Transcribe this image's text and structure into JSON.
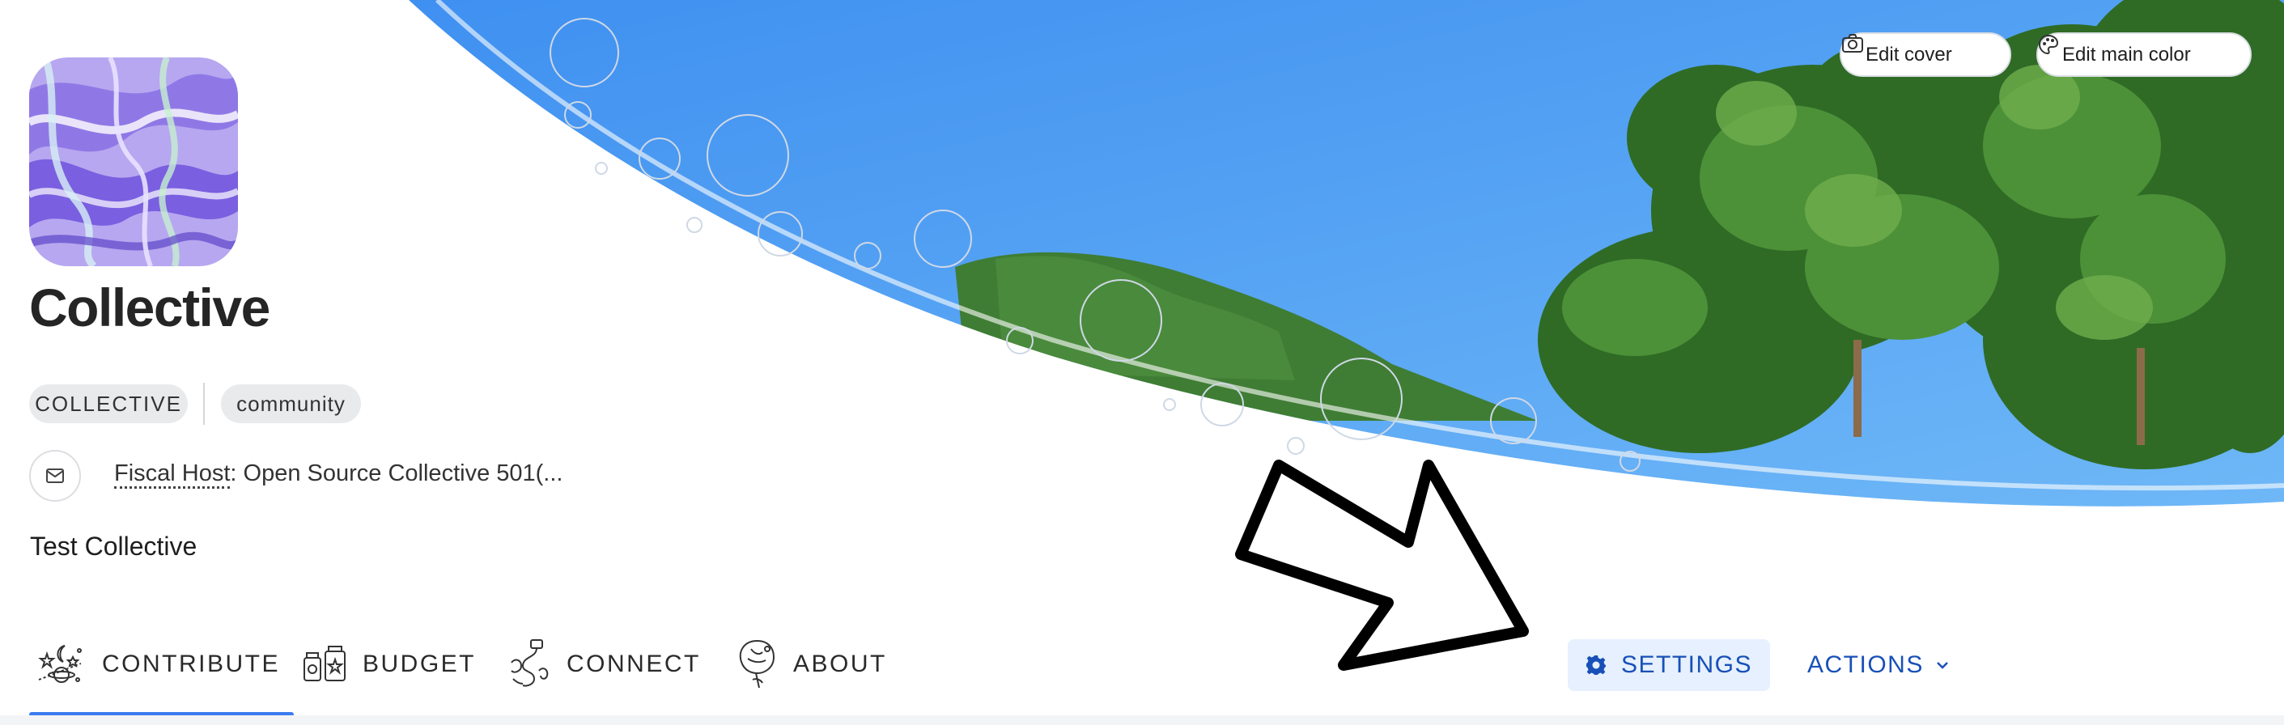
{
  "cover": {
    "edit_cover_label": "Edit cover",
    "edit_main_color_label": "Edit main color",
    "sky_color": "#4a9ff2",
    "foliage_color": "#2f6b25"
  },
  "collective": {
    "name": "Collective",
    "type_tag": "COLLECTIVE",
    "category_tag": "community",
    "fiscal_host_label": "Fiscal Host",
    "fiscal_host_value": ": Open Source Collective 501(...",
    "description": "Test Collective"
  },
  "nav": {
    "contribute": "CONTRIBUTE",
    "budget": "BUDGET",
    "connect": "CONNECT",
    "about": "ABOUT",
    "active": "CONTRIBUTE",
    "settings": "SETTINGS",
    "actions": "ACTIONS"
  },
  "icons": [
    "camera-icon",
    "palette-icon",
    "mail-icon",
    "gear-icon",
    "chevron-down-icon",
    "annotation-arrow"
  ],
  "colors": {
    "accent": "#3b7cf0",
    "action_text": "#1850b8",
    "settings_bg": "#e6f0ff"
  }
}
